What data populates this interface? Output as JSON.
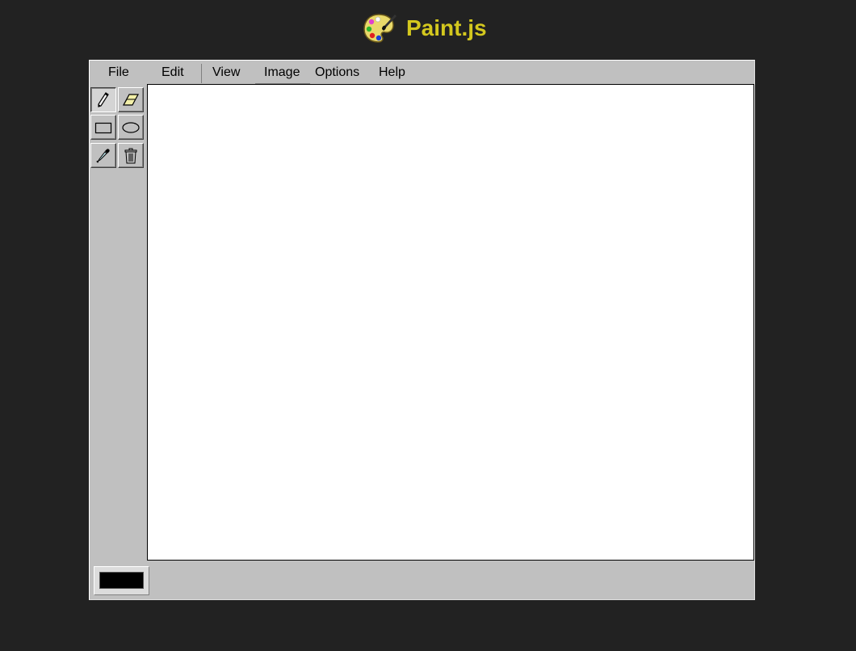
{
  "app": {
    "title": "Paint.js",
    "title_color": "#d4c81e",
    "logo_icon": "paint-palette-icon"
  },
  "menu": {
    "items": [
      {
        "label": "File"
      },
      {
        "label": "Edit"
      },
      {
        "label": "View"
      },
      {
        "label": "Image"
      },
      {
        "label": "Options"
      },
      {
        "label": "Help"
      }
    ],
    "active_item": "Image"
  },
  "tools": [
    {
      "name": "pencil",
      "icon": "pencil-icon",
      "active": true
    },
    {
      "name": "eraser",
      "icon": "eraser-icon",
      "active": false
    },
    {
      "name": "rectangle",
      "icon": "rectangle-icon",
      "active": false
    },
    {
      "name": "ellipse",
      "icon": "ellipse-icon",
      "active": false
    },
    {
      "name": "color-picker",
      "icon": "eyedropper-icon",
      "active": false
    },
    {
      "name": "clear",
      "icon": "trash-icon",
      "active": false
    }
  ],
  "colors": {
    "page_background": "#222222",
    "window_background": "#c0c0c0",
    "canvas_background": "#ffffff",
    "current_color": "#000000"
  }
}
